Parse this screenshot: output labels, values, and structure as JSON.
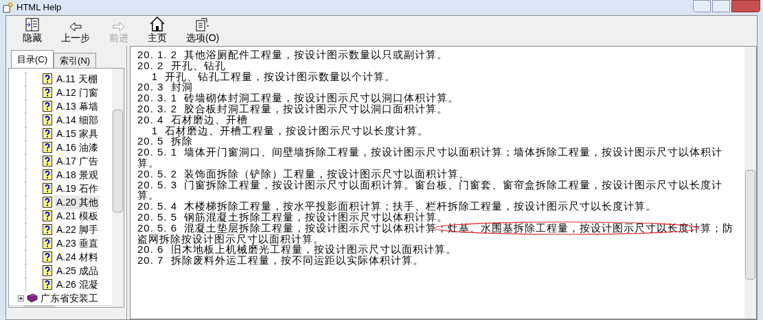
{
  "window": {
    "title": "HTML Help"
  },
  "toolbar": [
    {
      "label": "隐藏",
      "kind": "hide",
      "disabled": false
    },
    {
      "label": "上一步",
      "kind": "back",
      "disabled": false
    },
    {
      "label": "前进",
      "kind": "forward",
      "disabled": true
    },
    {
      "label": "主页",
      "kind": "home",
      "disabled": false
    },
    {
      "label": "选项(O)",
      "kind": "options",
      "disabled": false
    }
  ],
  "tabs": [
    {
      "label": "目录(C)",
      "selected": true
    },
    {
      "label": "索引(N)",
      "selected": false
    }
  ],
  "tree": [
    {
      "label": "A.11 天棚",
      "selected": false
    },
    {
      "label": "A.12 门窗",
      "selected": false
    },
    {
      "label": "A.13 幕墙",
      "selected": false
    },
    {
      "label": "A.14 细部",
      "selected": false
    },
    {
      "label": "A.15 家具",
      "selected": false
    },
    {
      "label": "A.16 油漆",
      "selected": false
    },
    {
      "label": "A.17 广告",
      "selected": false
    },
    {
      "label": "A.18 景观",
      "selected": false
    },
    {
      "label": "A.19 石作",
      "selected": false
    },
    {
      "label": "A.20 其他",
      "selected": true
    },
    {
      "label": "A.21 模板",
      "selected": false
    },
    {
      "label": "A.22 脚手",
      "selected": false
    },
    {
      "label": "A.23 垂直",
      "selected": false
    },
    {
      "label": "A.24 材料",
      "selected": false
    },
    {
      "label": "A.25 成品",
      "selected": false
    },
    {
      "label": "A.26 混凝",
      "selected": false
    }
  ],
  "tree_book": {
    "label": "广东省安装工",
    "expanded": false
  },
  "content": [
    {
      "text": "20. 1. 2  其他浴厕配件工程量，按设计图示数量以只或副计算。",
      "circled": false
    },
    {
      "text": "20. 2  开孔、钻孔",
      "circled": false
    },
    {
      "text": "    1  开孔、钻孔工程量，按设计图示数量以个计算。",
      "circled": false
    },
    {
      "text": "20. 3  封洞",
      "circled": false
    },
    {
      "text": "20. 3. 1  砖墙砌体封洞工程量，按设计图示尺寸以洞口体积计算。",
      "circled": false
    },
    {
      "text": "20. 3. 2  胶合板封洞工程量，按设计图示尺寸以洞口面积计算。",
      "circled": false
    },
    {
      "text": "20. 4  石材磨边、开槽",
      "circled": false
    },
    {
      "text": "    1  石材磨边、开槽工程量，按设计图示尺寸以长度计算。",
      "circled": false
    },
    {
      "text": "20. 5  拆除",
      "circled": false
    },
    {
      "text": "20. 5. 1  墙体开门窗洞口、间壁墙拆除工程量，按设计图示尺寸以面积计算；墙体拆除工程量，按设计图示尺寸以体积计算。",
      "circled": false
    },
    {
      "text": "20. 5. 2  装饰面拆除（铲除）工程量，按设计图示尺寸以面积计算。",
      "circled": false
    },
    {
      "text": "20. 5. 3  门窗拆除工程量，按设计图示尺寸以面积计算。窗台板、门窗套、窗帘盒拆除工程量，按设计图示尺寸以长度计算。",
      "circled": false
    },
    {
      "text": "20. 5. 4  木楼梯拆除工程量，按水平投影面积计算；扶手、栏杆拆除工程量，按设计图示尺寸以长度计算。",
      "circled": false
    },
    {
      "text": "20. 5. 5  钢筋混凝土拆除工程量，按设计图示尺寸以体积计算。",
      "circled": false
    },
    {
      "text": "20. 5. 6  混凝土垫层拆除工程量，按设计图示尺寸以体积计算；灶基、水围基拆除工程量，按设计图示尺寸以长度计算；防盗网拆除按设计图示尺寸以面积计算。",
      "circled": true
    },
    {
      "text": "20. 6  旧木地板上机械磨光工程量，按设计图示尺寸以面积计算。",
      "circled": false
    },
    {
      "text": "20. 7  拆除废料外运工程量，按不同运距以实际体积计算。",
      "circled": false
    }
  ]
}
